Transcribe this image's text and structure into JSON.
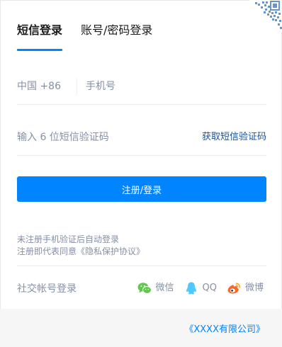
{
  "tabs": [
    {
      "label": "短信登录",
      "active": true
    },
    {
      "label": "账号/密码登录",
      "active": false
    }
  ],
  "phone": {
    "country_code": "中国 +86",
    "placeholder": "手机号",
    "value": ""
  },
  "sms": {
    "placeholder": "输入 6 位短信验证码",
    "value": "",
    "get_code_label": "获取短信验证码"
  },
  "submit_label": "注册/登录",
  "notice": {
    "line1": "未注册手机验证后自动登录",
    "line2_prefix": "注册即代表同意",
    "agreement_link": "《隐私保护协议》"
  },
  "social": {
    "label": "社交帐号登录",
    "items": [
      {
        "name": "微信",
        "icon": "wechat-icon",
        "color": "#60c84d"
      },
      {
        "name": "QQ",
        "icon": "qq-icon",
        "color": "#50c8fd"
      },
      {
        "name": "微博",
        "icon": "weibo-icon",
        "color": "#fb6622"
      }
    ]
  },
  "footer": {
    "company_link": "《XXXX有限公司》"
  },
  "colors": {
    "primary": "#0084ff",
    "muted": "#8590a6",
    "link": "#175199",
    "divider": "#ebebeb"
  }
}
